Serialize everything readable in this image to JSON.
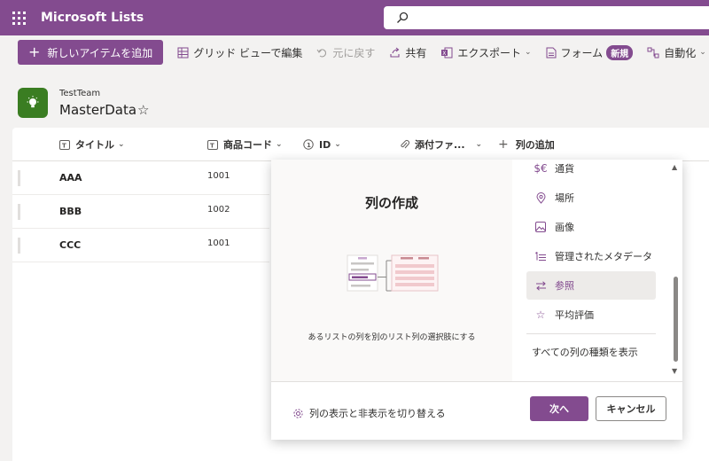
{
  "appbar": {
    "title": "Microsoft Lists",
    "search_placeholder": ""
  },
  "commands": {
    "new_item": "新しいアイテムを追加",
    "grid_view": "グリッド ビューで編集",
    "undo": "元に戻す",
    "share": "共有",
    "export": "エクスポート",
    "form": "フォーム",
    "form_badge": "新規",
    "automate": "自動化"
  },
  "list": {
    "team": "TestTeam",
    "name": "MasterData"
  },
  "columns": {
    "title": "タイトル",
    "product_code": "商品コード",
    "id": "ID",
    "attachments": "添付ファ...",
    "add_column": "列の追加"
  },
  "rows": [
    {
      "title": "AAA",
      "code": "1001"
    },
    {
      "title": "BBB",
      "code": "1002"
    },
    {
      "title": "CCC",
      "code": "1001"
    }
  ],
  "dialog": {
    "title": "列の作成",
    "description": "あるリストの列を別のリスト列の選択肢にする",
    "types": [
      "通貨",
      "場所",
      "画像",
      "管理されたメタデータ",
      "参照",
      "平均評価"
    ],
    "icons": [
      "currency-icon",
      "location-icon",
      "image-icon",
      "managed-metadata-icon",
      "lookup-icon",
      "rating-icon"
    ],
    "selected": "参照",
    "show_all": "すべての列の種類を表示",
    "toggle_columns": "列の表示と非表示を切り替える",
    "next": "次へ",
    "cancel": "キャンセル"
  },
  "colors": {
    "accent": "#834b8f",
    "list_icon": "#3a7d22"
  }
}
